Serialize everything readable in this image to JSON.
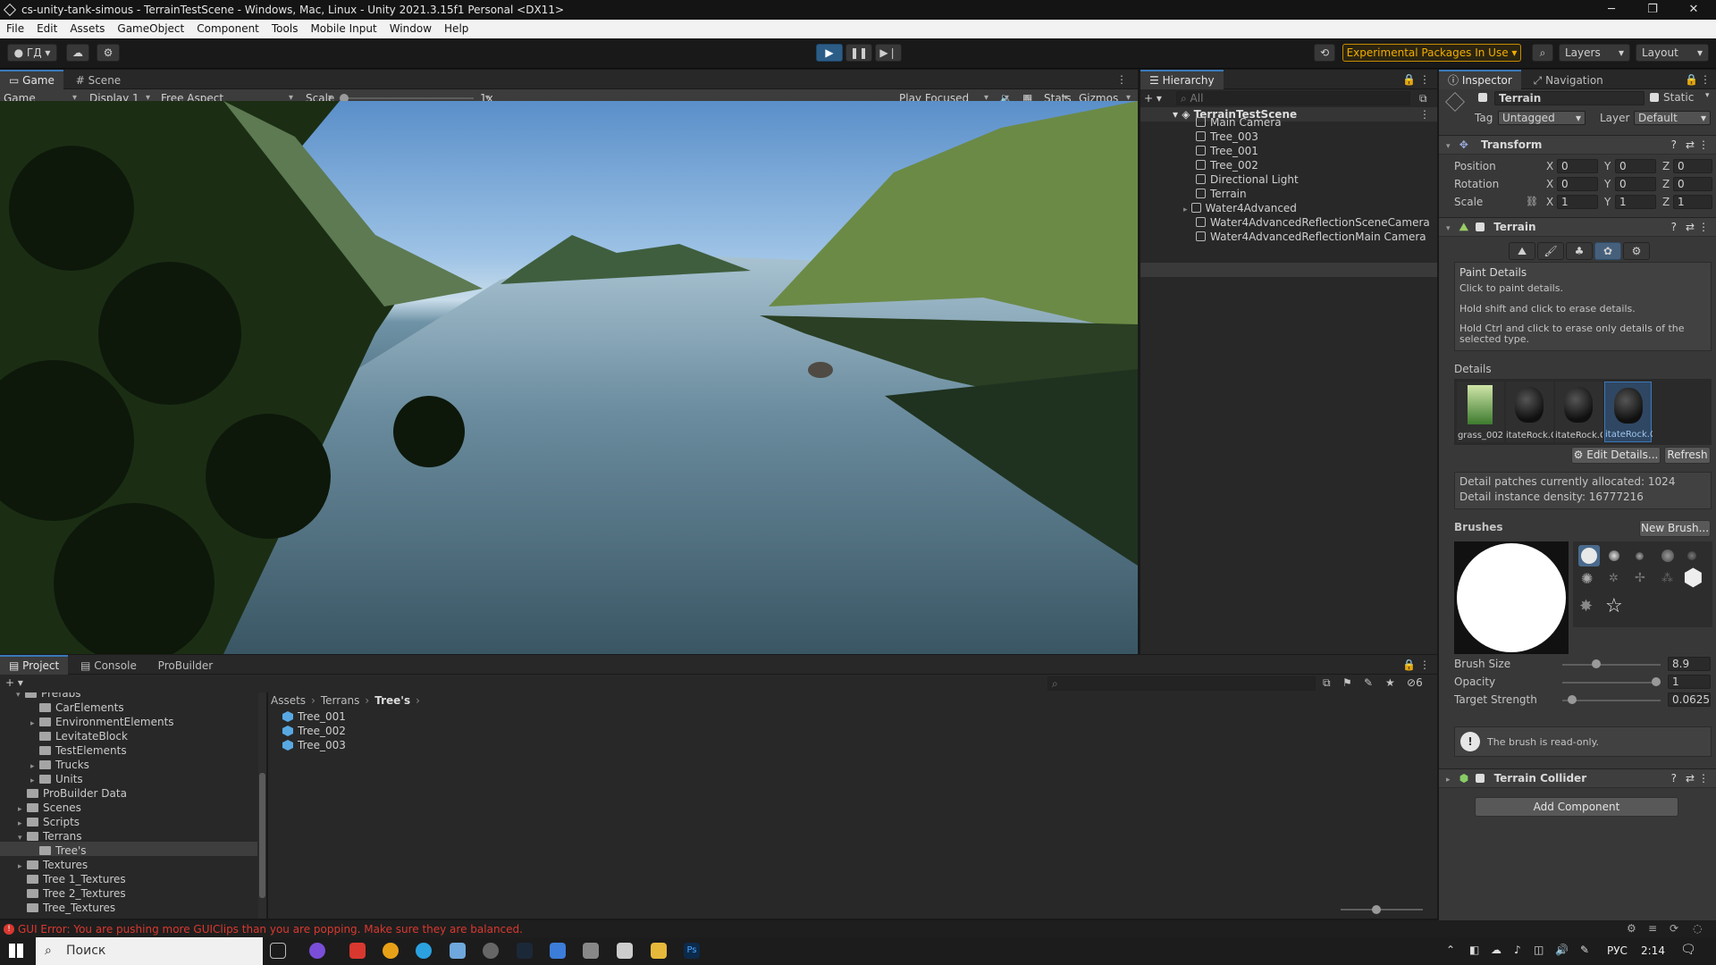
{
  "window": {
    "title": "cs-unity-tank-simous - TerrainTestScene - Windows, Mac, Linux - Unity 2021.3.15f1 Personal <DX11>"
  },
  "menu": [
    "File",
    "Edit",
    "Assets",
    "GameObject",
    "Component",
    "Tools",
    "Mobile Input",
    "Window",
    "Help"
  ],
  "toolbar": {
    "account": "ГД",
    "experimental": "Experimental Packages In Use",
    "layers": "Layers",
    "layout": "Layout"
  },
  "game_panel": {
    "tabs": [
      "Game",
      "Scene"
    ],
    "game_dd": "Game",
    "display": "Display 1",
    "aspect": "Free Aspect",
    "scale_label": "Scale",
    "scale_value": "1x",
    "play_focused": "Play Focused",
    "stats": "Stats",
    "gizmos": "Gizmos"
  },
  "hierarchy": {
    "tab": "Hierarchy",
    "search_placeholder": "All",
    "scene": "TerrainTestScene",
    "items": [
      "Main Camera",
      "Tree_003",
      "Tree_001",
      "Tree_002",
      "Directional Light",
      "Terrain",
      "Water4Advanced",
      "Water4AdvancedReflectionSceneCamera",
      "Water4AdvancedReflectionMain Camera"
    ]
  },
  "inspector": {
    "tabs": [
      "Inspector",
      "Navigation"
    ],
    "object_name": "Terrain",
    "static": "Static",
    "tag_label": "Tag",
    "tag_value": "Untagged",
    "layer_label": "Layer",
    "layer_value": "Default",
    "transform": {
      "header": "Transform",
      "position_label": "Position",
      "rotation_label": "Rotation",
      "scale_label": "Scale",
      "x": "X",
      "y": "Y",
      "z": "Z",
      "position": [
        "0",
        "0",
        "0"
      ],
      "rotation": [
        "0",
        "0",
        "0"
      ],
      "scale": [
        "1",
        "1",
        "1"
      ]
    },
    "terrain": {
      "header": "Terrain",
      "paint_title": "Paint Details",
      "hint1": "Click to paint details.",
      "hint2": "Hold shift and click to erase details.",
      "hint3": "Hold Ctrl and click to erase only details of the selected type.",
      "details_label": "Details",
      "detail_items": [
        "grass_002",
        "itateRock.C",
        "itateRock.C",
        "itateRock.C"
      ],
      "edit_details": "Edit Details...",
      "refresh": "Refresh",
      "patches": "Detail patches currently allocated: 1024",
      "density": "Detail instance density: 16777216",
      "brushes_label": "Brushes",
      "new_brush": "New Brush...",
      "brush_size_label": "Brush Size",
      "brush_size": "8.9",
      "brush_size_frac": 0.33,
      "opacity_label": "Opacity",
      "opacity": "1",
      "opacity_frac": 1.0,
      "target_label": "Target Strength",
      "target": "0.0625",
      "target_frac": 0.0625,
      "readonly": "The brush is read-only."
    },
    "collider": {
      "header": "Terrain Collider"
    },
    "add_component": "Add Component"
  },
  "project": {
    "tabs": [
      "Project",
      "Console",
      "ProBuilder"
    ],
    "search_count": "6",
    "breadcrumb": [
      "Assets",
      "Terrans",
      "Tree's"
    ],
    "tree": [
      {
        "label": "Prefabs",
        "arrow": "▾"
      },
      {
        "label": "CarElements",
        "arrow": ""
      },
      {
        "label": "EnvironmentElements",
        "arrow": "▸"
      },
      {
        "label": "LevitateBlock",
        "arrow": ""
      },
      {
        "label": "TestElements",
        "arrow": ""
      },
      {
        "label": "Trucks",
        "arrow": "▸"
      },
      {
        "label": "Units",
        "arrow": "▸"
      },
      {
        "label": "ProBuilder Data",
        "arrow": ""
      },
      {
        "label": "Scenes",
        "arrow": "▸"
      },
      {
        "label": "Scripts",
        "arrow": "▸"
      },
      {
        "label": "Terrans",
        "arrow": "▾"
      },
      {
        "label": "Tree's",
        "arrow": ""
      },
      {
        "label": "Textures",
        "arrow": "▸"
      },
      {
        "label": "Tree 1_Textures",
        "arrow": ""
      },
      {
        "label": "Tree 2_Textures",
        "arrow": ""
      },
      {
        "label": "Tree_Textures",
        "arrow": ""
      }
    ],
    "assets": [
      "Tree_001",
      "Tree_002",
      "Tree_003"
    ]
  },
  "status": {
    "error": "GUI Error: You are pushing more GUIClips than you are popping. Make sure they are balanced."
  },
  "taskbar": {
    "search": "Поиск",
    "lang": "РУС",
    "time": "2:14"
  },
  "colors": {
    "accent": "#3a79bb",
    "error": "#d9382f",
    "warning_border": "#c58c00"
  }
}
